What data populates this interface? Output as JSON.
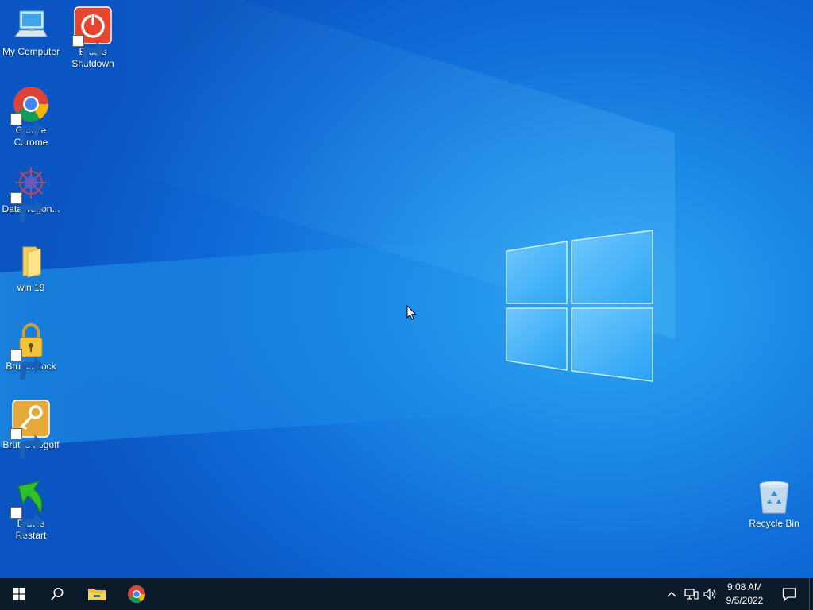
{
  "desktop_icons": [
    {
      "id": "my-computer",
      "label": "My Computer",
      "icon": "computer-icon"
    },
    {
      "id": "brutus-shutdown",
      "label": "Brutus Shutdown",
      "icon": "power-icon"
    },
    {
      "id": "google-chrome",
      "label": "Google Chrome",
      "icon": "chrome-icon"
    },
    {
      "id": "datawagon",
      "label": "DataWagon...",
      "icon": "datawagon-icon"
    },
    {
      "id": "win19",
      "label": "win 19",
      "icon": "folder-icon"
    },
    {
      "id": "brutus-lock",
      "label": "Brutus Lock",
      "icon": "padlock-icon"
    },
    {
      "id": "brutus-logoff",
      "label": "Brutus Logoff",
      "icon": "key-icon"
    },
    {
      "id": "brutus-restart",
      "label": "Brutus Restart",
      "icon": "green-arrow-icon"
    },
    {
      "id": "recycle-bin",
      "label": "Recycle Bin",
      "icon": "recycle-bin-icon"
    }
  ],
  "taskbar": {
    "start_icon": "windows-start-icon",
    "search_icon": "search-icon",
    "pinned": [
      "file-explorer-icon",
      "chrome-icon"
    ],
    "tray_icons": [
      "chevron-up-icon",
      "network-icon",
      "volume-icon"
    ],
    "clock": {
      "time": "9:08 AM",
      "date": "9/5/2022"
    },
    "notification_icon": "action-center-icon"
  },
  "colors": {
    "desktop_blue": "#1a86e4",
    "taskbar": "#0c1a2a",
    "brutus_red": "#e8452f",
    "brutus_gold": "#e5a93a"
  }
}
